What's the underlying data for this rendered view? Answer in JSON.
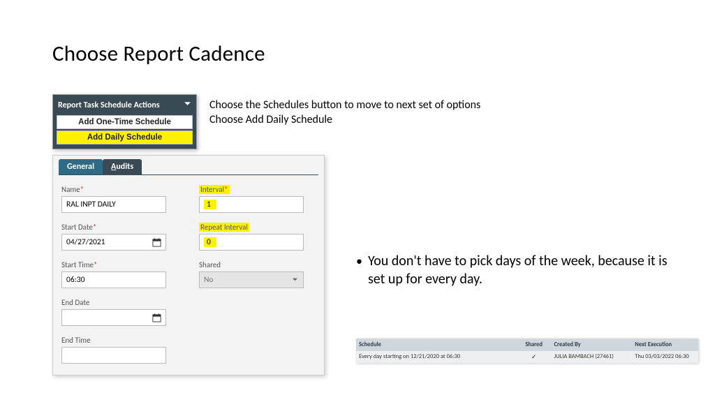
{
  "title": "Choose Report Cadence",
  "instructions": {
    "line1": "Choose the Schedules button to move to next set of options",
    "line2": "Choose Add Daily Schedule"
  },
  "dropdown": {
    "header": "Report Task Schedule Actions",
    "options": [
      "Add One-Time Schedule",
      "Add Daily Schedule"
    ]
  },
  "tabs": {
    "general": "General",
    "audits_prefix": "A",
    "audits_rest": "udits"
  },
  "form": {
    "name_label": "Name",
    "name_value": "RAL INPT DAILY",
    "start_date_label": "Start Date",
    "start_date_value": "04/27/2021",
    "start_time_label": "Start Time",
    "start_time_value": "06:30",
    "end_date_label": "End Date",
    "end_date_value": "",
    "end_time_label": "End Time",
    "end_time_value": "",
    "interval_label": "Interval",
    "interval_value": "1",
    "repeat_interval_label": "Repeat Interval",
    "repeat_interval_value": "0",
    "shared_label": "Shared",
    "shared_value": "No"
  },
  "bullet": "You don't have to pick days of the week, because it is set up for every day.",
  "schedule_table": {
    "headers": {
      "schedule": "Schedule",
      "shared": "Shared",
      "created_by": "Created By",
      "next_exec": "Next Execution"
    },
    "row": {
      "schedule": "Every day starting on 12/21/2020 at 06:30",
      "shared": "✓",
      "created_by": "JULIA BAMBACH (27461)",
      "next_exec": "Thu 03/03/2022 06:30"
    }
  }
}
